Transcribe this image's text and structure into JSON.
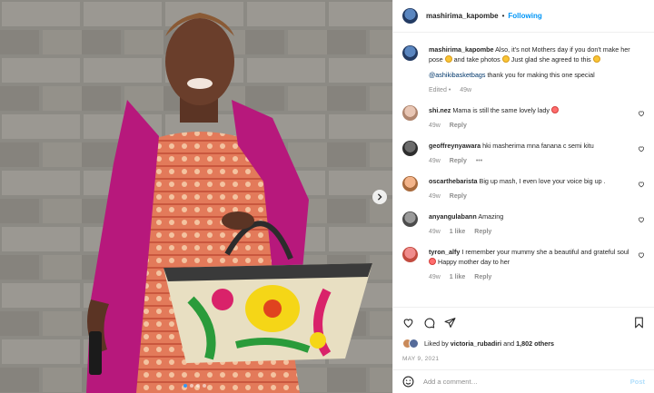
{
  "header": {
    "username": "mashirima_kapombe",
    "separator": "•",
    "follow_label": "Following"
  },
  "caption": {
    "username": "mashirima_kapombe",
    "text_1": "Also, it's not Mothers day if you don't make her pose",
    "text_2": "and take photos",
    "text_3": "Just glad she agreed to this",
    "mention": "@ashikibasketbags",
    "text_4": "thank you for making this one special",
    "edited": "Edited",
    "time": "49w"
  },
  "comments": [
    {
      "username": "shi.nez",
      "text": "Mama is still the same lovely lady",
      "time": "49w",
      "likes": "",
      "reply": "Reply"
    },
    {
      "username": "geoffreynyawara",
      "text": "hki masherima mna fanana c semi kitu",
      "time": "49w",
      "likes": "",
      "reply": "Reply",
      "more": "•••"
    },
    {
      "username": "oscarthebarista",
      "text": "Big up mash, I even love your voice big up .",
      "time": "49w",
      "likes": "",
      "reply": "Reply"
    },
    {
      "username": "anyangulabann",
      "text": "Amazing",
      "time": "49w",
      "likes": "1 like",
      "reply": "Reply"
    },
    {
      "username": "tyron_alfy",
      "text_1": "I remember your mummy she a beautiful and grateful soul",
      "text_2": "Happy mother day to her",
      "time": "49w",
      "likes": "1 like",
      "reply": "Reply"
    }
  ],
  "likes": {
    "prefix": "Liked by",
    "user": "victoria_rubadiri",
    "and": "and",
    "others": "1,802 others"
  },
  "date": "MAY 9, 2021",
  "add_comment": {
    "placeholder": "Add a comment…",
    "post_label": "Post"
  },
  "icons": [
    "emoji-icon",
    "heart-icon",
    "comment-icon",
    "share-icon",
    "bookmark-icon",
    "chevron-right-icon"
  ]
}
